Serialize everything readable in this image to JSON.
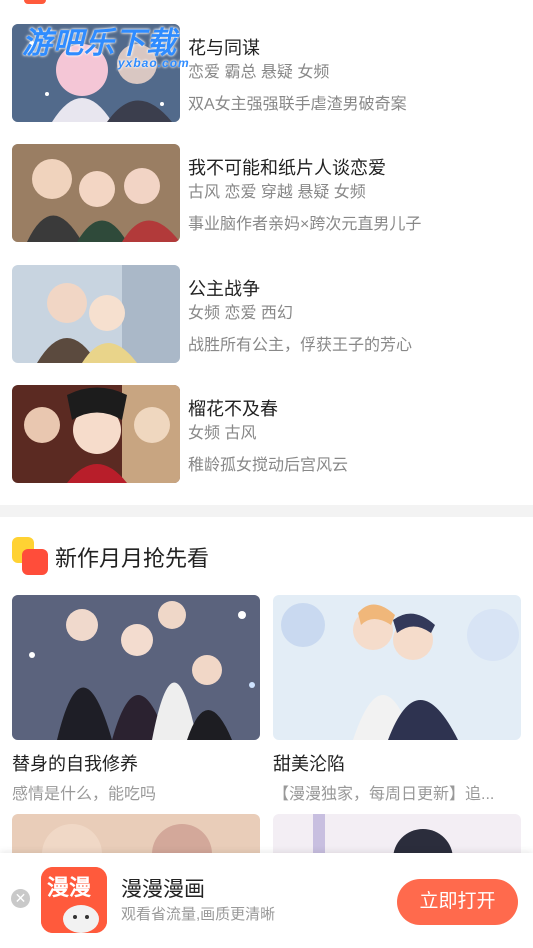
{
  "watermark": {
    "text": "游吧乐下载",
    "sub": "yxbao.com"
  },
  "list": [
    {
      "title": "花与同谋",
      "tags": "恋爱 霸总 悬疑 女频",
      "desc": "双A女主强强联手虐渣男破奇案"
    },
    {
      "title": "我不可能和纸片人谈恋爱",
      "tags": "古风 恋爱 穿越 悬疑 女频",
      "desc": "事业脑作者亲妈×跨次元直男儿子"
    },
    {
      "title": "公主战争",
      "tags": "女频 恋爱 西幻",
      "desc": "战胜所有公主，俘获王子的芳心"
    },
    {
      "title": "榴花不及春",
      "tags": "女频 古风",
      "desc": "稚龄孤女搅动后宫风云"
    }
  ],
  "section": {
    "title": "新作月月抢先看"
  },
  "cards": [
    {
      "title": "替身的自我修养",
      "sub": "感情是什么，能吃吗"
    },
    {
      "title": "甜美沦陷",
      "sub": "【漫漫独家，每周日更新】追..."
    }
  ],
  "banner": {
    "app_name": "漫漫漫画",
    "app_desc": "观看省流量,画质更清晰",
    "open_label": "立即打开",
    "icon_text": "漫漫"
  },
  "colors": {
    "accent": "#ff6a4d",
    "watermark": "#2f8cff"
  }
}
